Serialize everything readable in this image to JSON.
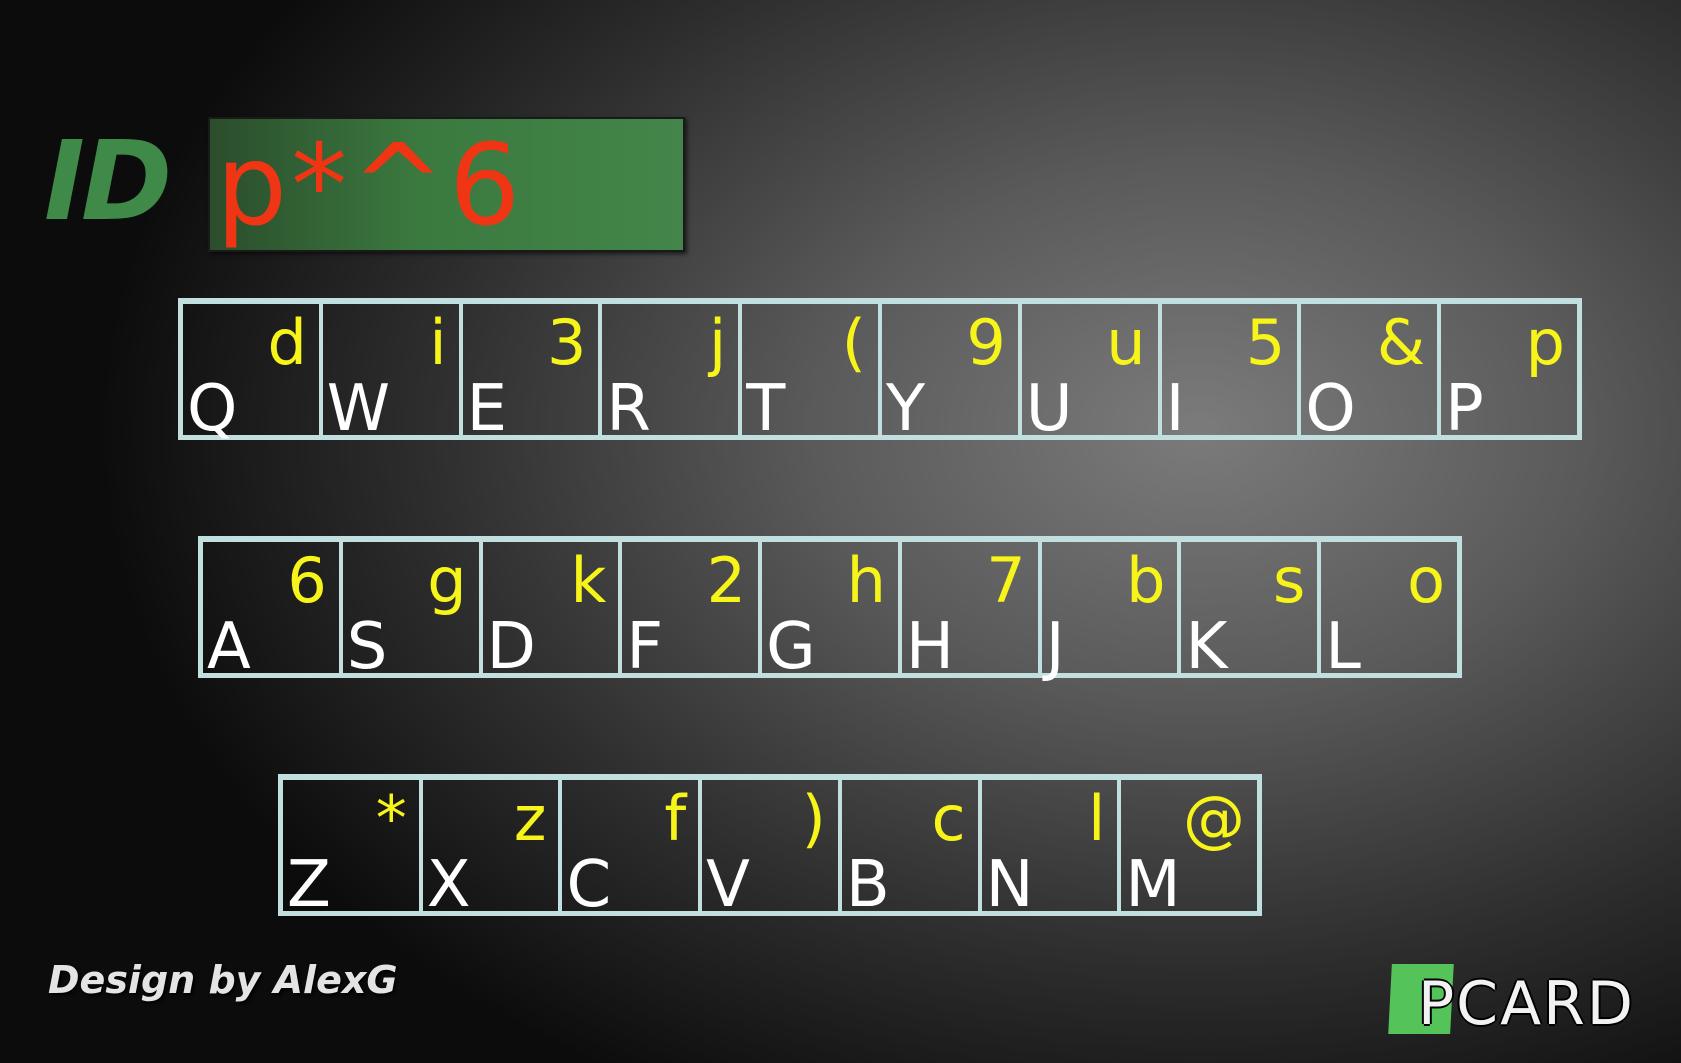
{
  "id_label": "ID",
  "id_value": "p*^6",
  "keyboard": {
    "rows": [
      {
        "keys": [
          {
            "main": "Q",
            "alt": "d"
          },
          {
            "main": "W",
            "alt": "i"
          },
          {
            "main": "E",
            "alt": "3"
          },
          {
            "main": "R",
            "alt": "j"
          },
          {
            "main": "T",
            "alt": "("
          },
          {
            "main": "Y",
            "alt": "9"
          },
          {
            "main": "U",
            "alt": "u"
          },
          {
            "main": "I",
            "alt": "5"
          },
          {
            "main": "O",
            "alt": "&"
          },
          {
            "main": "P",
            "alt": "p"
          }
        ]
      },
      {
        "keys": [
          {
            "main": "A",
            "alt": "6"
          },
          {
            "main": "S",
            "alt": "g"
          },
          {
            "main": "D",
            "alt": "k"
          },
          {
            "main": "F",
            "alt": "2"
          },
          {
            "main": "G",
            "alt": "h"
          },
          {
            "main": "H",
            "alt": "7"
          },
          {
            "main": "J",
            "alt": "b"
          },
          {
            "main": "K",
            "alt": "s"
          },
          {
            "main": "L",
            "alt": "o"
          }
        ]
      },
      {
        "keys": [
          {
            "main": "Z",
            "alt": "*"
          },
          {
            "main": "X",
            "alt": "z"
          },
          {
            "main": "C",
            "alt": "f"
          },
          {
            "main": "V",
            "alt": ")"
          },
          {
            "main": "B",
            "alt": "c"
          },
          {
            "main": "N",
            "alt": "l"
          },
          {
            "main": "M",
            "alt": "@"
          }
        ]
      }
    ]
  },
  "credit": "Design by AlexG",
  "logo_text": "PCARD",
  "colors": {
    "id_label": "#3f8a48",
    "id_value": "#f03515",
    "key_border": "#c2dfe0",
    "key_main": "#ffffff",
    "key_alt": "#f7f41a",
    "logo_square": "#54c35a"
  }
}
